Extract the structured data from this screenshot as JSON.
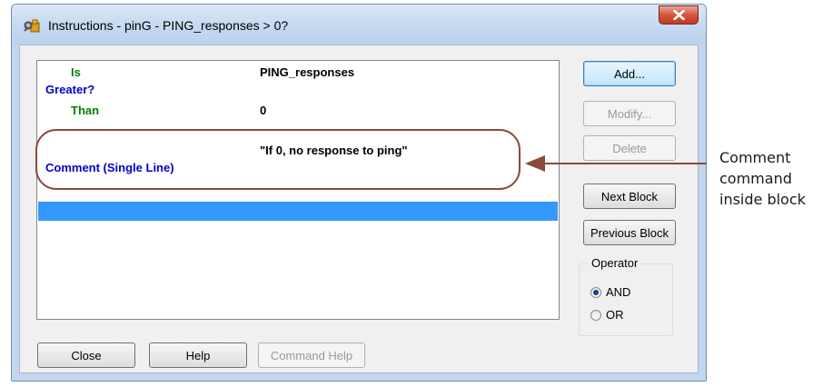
{
  "window": {
    "title": "Instructions - pinG - PING_responses > 0?",
    "close_icon": "close-x-icon",
    "app_icon": "tools-icon"
  },
  "instruction_list": {
    "rows": [
      {
        "keyword": "Is",
        "value": "PING_responses"
      },
      {
        "keyword": "Greater?",
        "value": ""
      },
      {
        "keyword": "Than",
        "value": "0"
      },
      {
        "keyword": "",
        "value": "\"If 0, no response to ping\""
      },
      {
        "keyword": "Comment (Single Line)",
        "value": ""
      }
    ],
    "colors": {
      "condition_keyword": "#008000",
      "command_keyword": "#0000cc",
      "selection": "#3399ff"
    }
  },
  "buttons": {
    "add": "Add...",
    "modify": "Modify...",
    "delete": "Delete",
    "next_block": "Next Block",
    "previous_block": "Previous Block",
    "close": "Close",
    "help": "Help",
    "command_help": "Command Help"
  },
  "operator": {
    "label": "Operator",
    "options": [
      "AND",
      "OR"
    ],
    "selected": "AND"
  },
  "callout": {
    "text_lines": [
      "Comment",
      "command",
      "inside block"
    ],
    "color": "#8b4a3c"
  }
}
